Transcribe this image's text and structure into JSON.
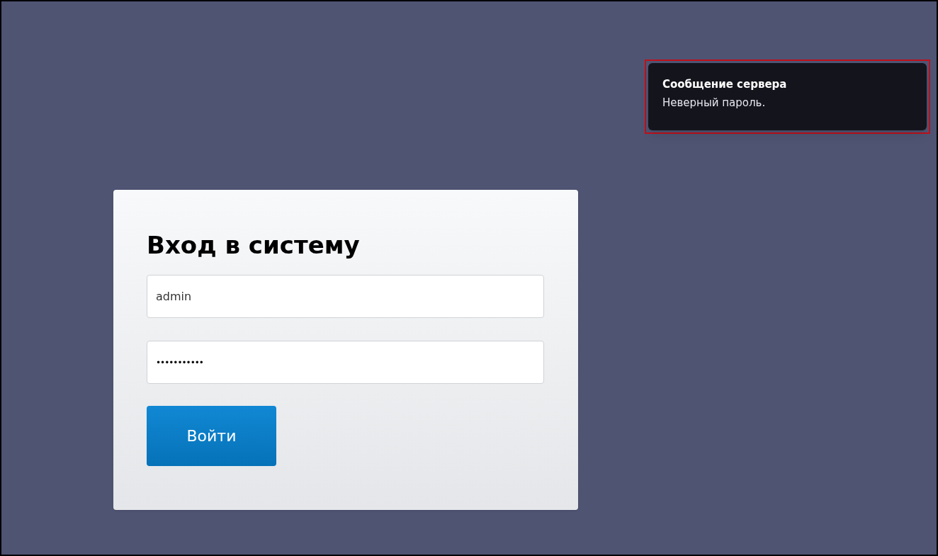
{
  "toast": {
    "title": "Сообщение сервера",
    "message": "Неверный пароль.",
    "highlighted": true
  },
  "login": {
    "title": "Вход в систему",
    "username": "admin",
    "password": "•••••••••••",
    "button": "Войти"
  }
}
